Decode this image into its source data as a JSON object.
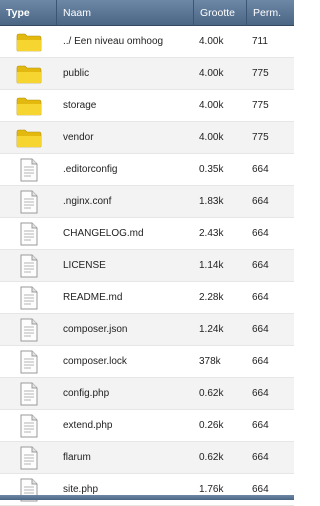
{
  "header": {
    "type": "Type",
    "name": "Naam",
    "size": "Grootte",
    "perm": "Perm."
  },
  "rows": [
    {
      "icon": "folder-icon",
      "name": "../ Een niveau omhoog",
      "size": "4.00k",
      "perm": "711"
    },
    {
      "icon": "folder-icon",
      "name": "public",
      "size": "4.00k",
      "perm": "775"
    },
    {
      "icon": "folder-icon",
      "name": "storage",
      "size": "4.00k",
      "perm": "775"
    },
    {
      "icon": "folder-icon",
      "name": "vendor",
      "size": "4.00k",
      "perm": "775"
    },
    {
      "icon": "file-icon",
      "name": ".editorconfig",
      "size": "0.35k",
      "perm": "664"
    },
    {
      "icon": "file-icon",
      "name": ".nginx.conf",
      "size": "1.83k",
      "perm": "664"
    },
    {
      "icon": "file-icon",
      "name": "CHANGELOG.md",
      "size": "2.43k",
      "perm": "664"
    },
    {
      "icon": "file-icon",
      "name": "LICENSE",
      "size": "1.14k",
      "perm": "664"
    },
    {
      "icon": "file-icon",
      "name": "README.md",
      "size": "2.28k",
      "perm": "664"
    },
    {
      "icon": "file-icon",
      "name": "composer.json",
      "size": "1.24k",
      "perm": "664"
    },
    {
      "icon": "file-icon",
      "name": "composer.lock",
      "size": "378k",
      "perm": "664"
    },
    {
      "icon": "file-icon",
      "name": "config.php",
      "size": "0.62k",
      "perm": "664"
    },
    {
      "icon": "file-icon",
      "name": "extend.php",
      "size": "0.26k",
      "perm": "664"
    },
    {
      "icon": "file-icon",
      "name": "flarum",
      "size": "0.62k",
      "perm": "664"
    },
    {
      "icon": "file-icon",
      "name": "site.php",
      "size": "1.76k",
      "perm": "664"
    }
  ],
  "colors": {
    "header": "#5a7594",
    "folder": "#f5cf1d",
    "row_alt": "#f3f3f3"
  }
}
